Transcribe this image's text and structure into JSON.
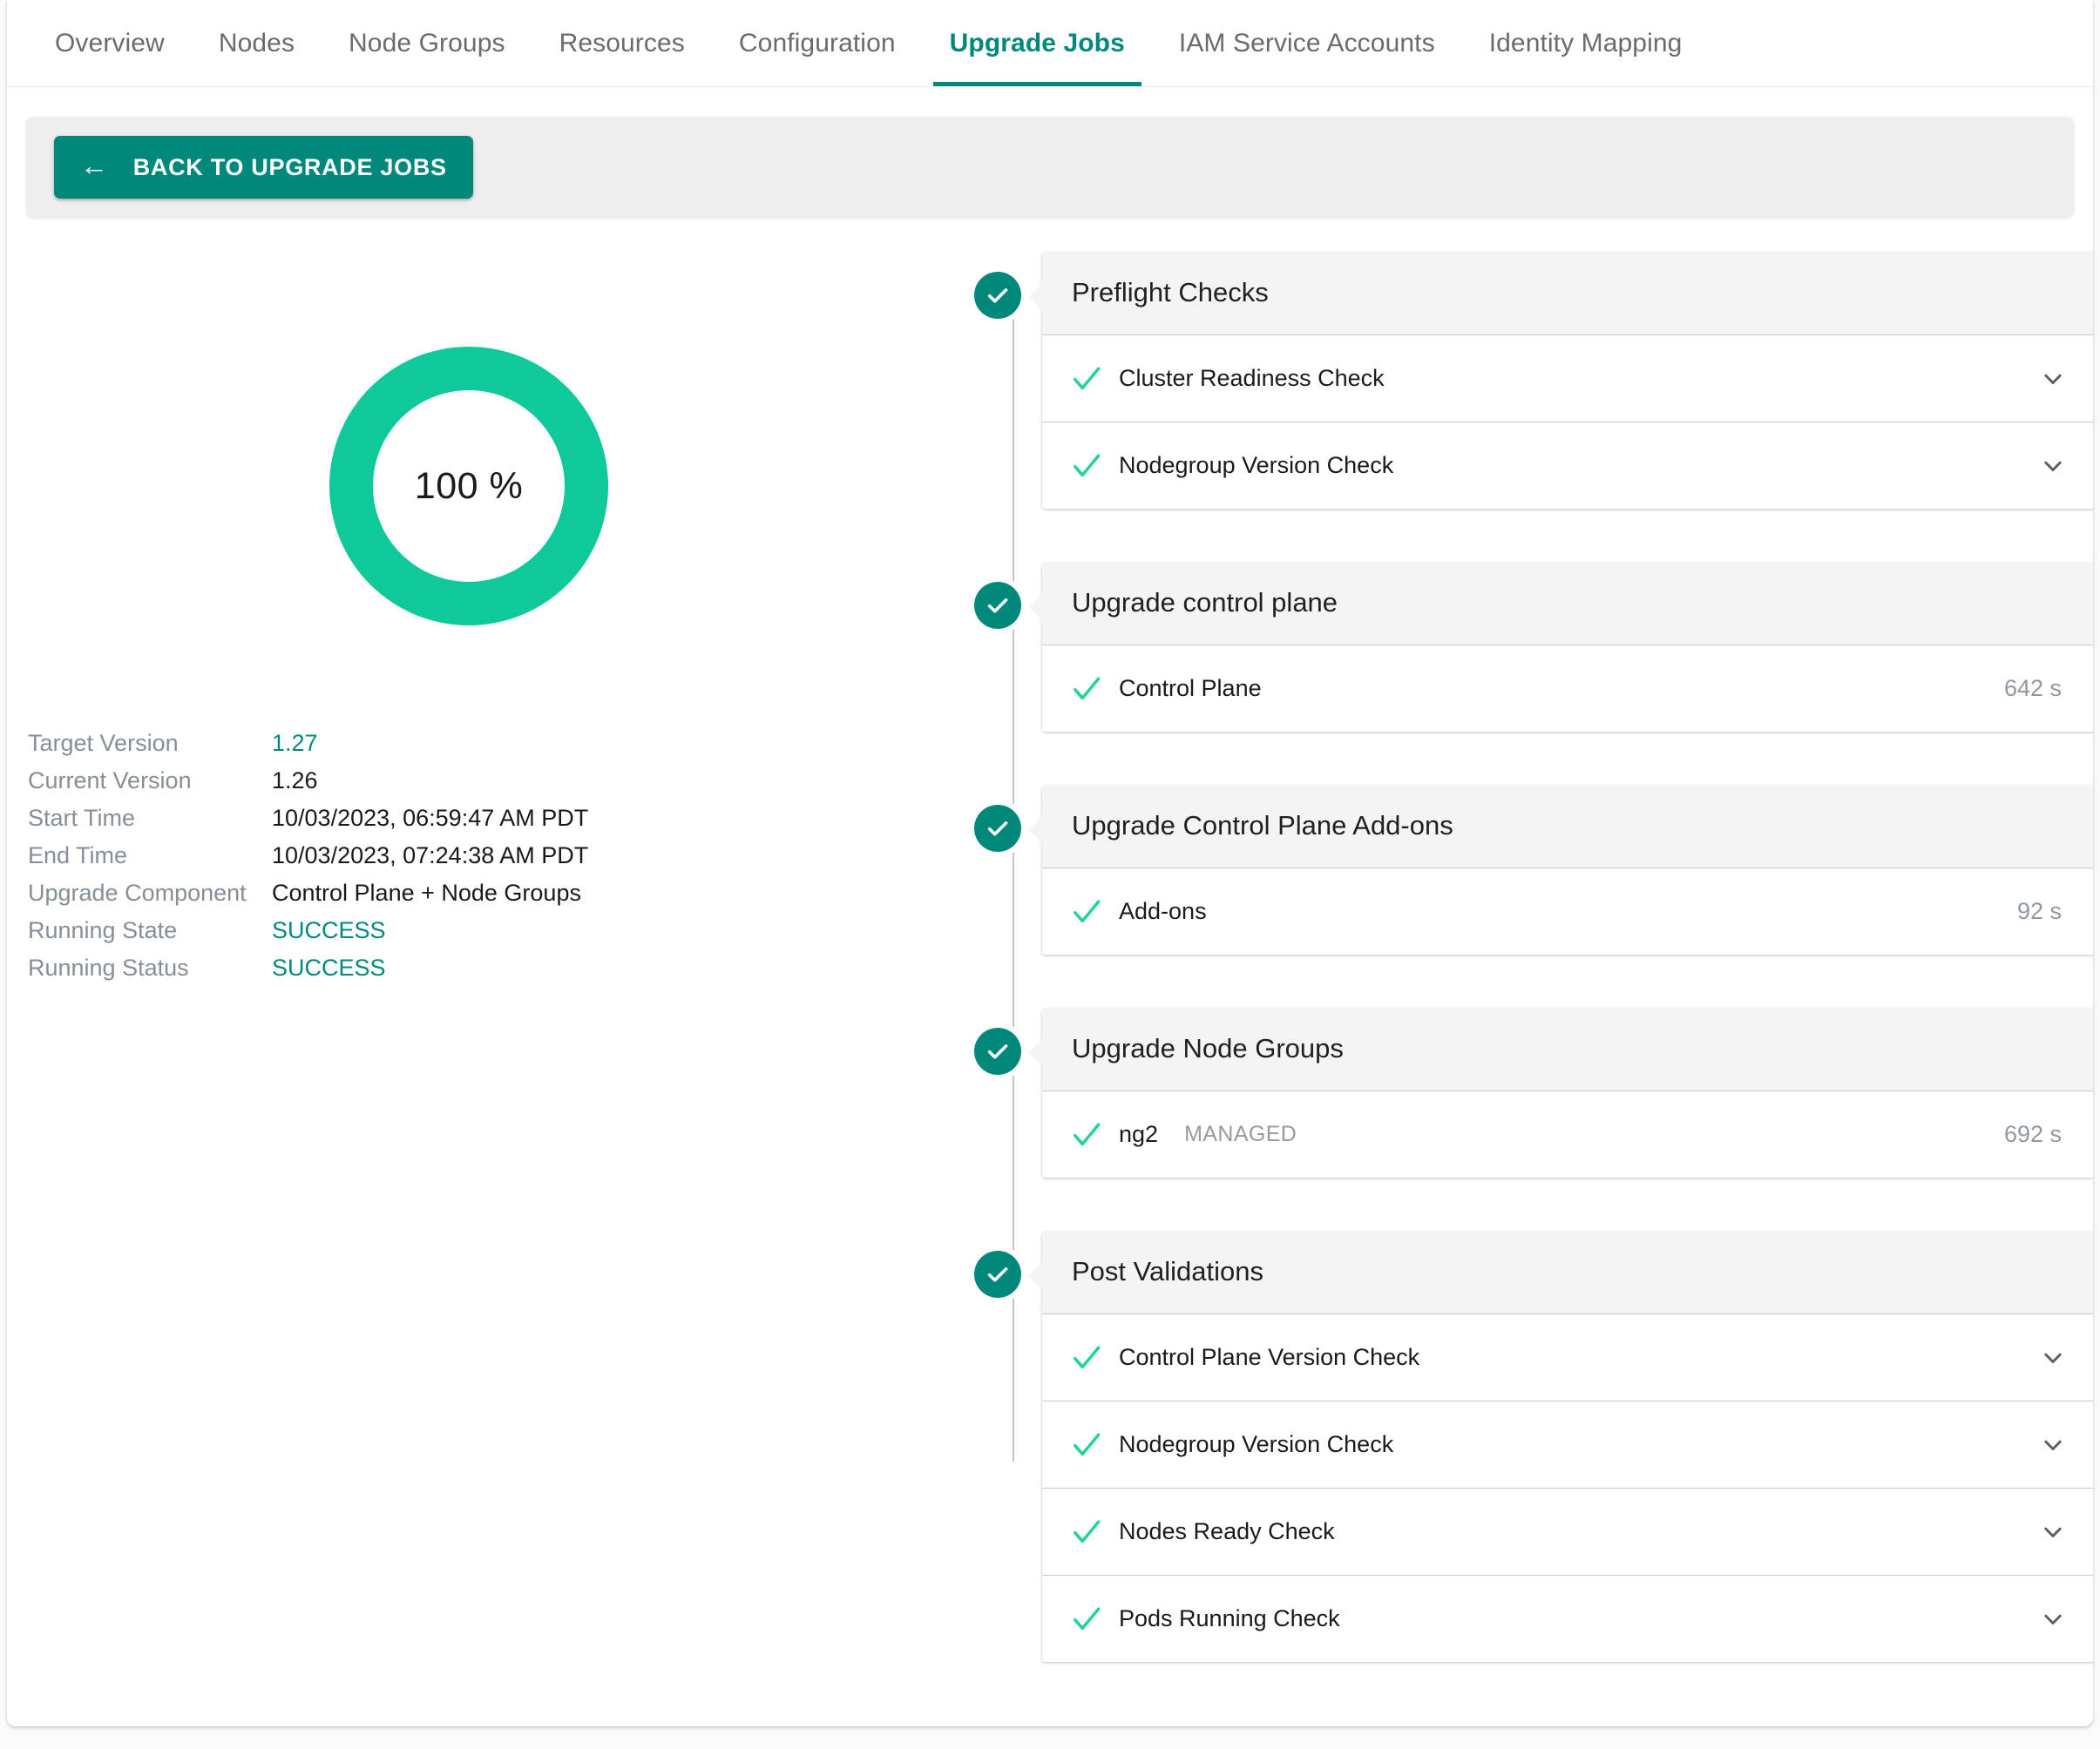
{
  "tabs": [
    {
      "label": "Overview",
      "active": false
    },
    {
      "label": "Nodes",
      "active": false
    },
    {
      "label": "Node Groups",
      "active": false
    },
    {
      "label": "Resources",
      "active": false
    },
    {
      "label": "Configuration",
      "active": false
    },
    {
      "label": "Upgrade Jobs",
      "active": true
    },
    {
      "label": "IAM Service Accounts",
      "active": false
    },
    {
      "label": "Identity Mapping",
      "active": false
    }
  ],
  "toolbar": {
    "back_label": "BACK TO UPGRADE JOBS",
    "back_arrow": "←"
  },
  "progress": {
    "percent_label": "100 %",
    "percent_value": 100,
    "ring_color": "#10c99a"
  },
  "details": [
    {
      "key": "Target Version",
      "value": "1.27",
      "accent": true
    },
    {
      "key": "Current Version",
      "value": "1.26",
      "accent": false
    },
    {
      "key": "Start Time",
      "value": "10/03/2023, 06:59:47 AM PDT",
      "accent": false
    },
    {
      "key": "End Time",
      "value": "10/03/2023, 07:24:38 AM PDT",
      "accent": false
    },
    {
      "key": "Upgrade Component",
      "value": "Control Plane + Node Groups",
      "accent": false
    },
    {
      "key": "Running State",
      "value": "SUCCESS",
      "accent": true
    },
    {
      "key": "Running Status",
      "value": "SUCCESS",
      "accent": true
    }
  ],
  "steps": [
    {
      "title": "Preflight Checks",
      "status_icon": "check-circle-icon",
      "items": [
        {
          "label": "Cluster Readiness Check",
          "tag": "",
          "duration": "",
          "expandable": true
        },
        {
          "label": "Nodegroup Version Check",
          "tag": "",
          "duration": "",
          "expandable": true
        }
      ]
    },
    {
      "title": "Upgrade control plane",
      "status_icon": "check-circle-icon",
      "items": [
        {
          "label": "Control Plane",
          "tag": "",
          "duration": "642 s",
          "expandable": false
        }
      ]
    },
    {
      "title": "Upgrade Control Plane Add-ons",
      "status_icon": "check-circle-icon",
      "items": [
        {
          "label": "Add-ons",
          "tag": "",
          "duration": "92 s",
          "expandable": false
        }
      ]
    },
    {
      "title": "Upgrade Node Groups",
      "status_icon": "check-circle-icon",
      "items": [
        {
          "label": "ng2",
          "tag": "MANAGED",
          "duration": "692 s",
          "expandable": false
        }
      ]
    },
    {
      "title": "Post Validations",
      "status_icon": "check-circle-icon",
      "items": [
        {
          "label": "Control Plane Version Check",
          "tag": "",
          "duration": "",
          "expandable": true
        },
        {
          "label": "Nodegroup Version Check",
          "tag": "",
          "duration": "",
          "expandable": true
        },
        {
          "label": "Nodes Ready Check",
          "tag": "",
          "duration": "",
          "expandable": true
        },
        {
          "label": "Pods Running Check",
          "tag": "",
          "duration": "",
          "expandable": true
        }
      ]
    }
  ],
  "colors": {
    "accent": "#00897b",
    "success_check": "#1fd39c",
    "header_bg": "#f4f4f4",
    "muted_text": "#868e96"
  }
}
